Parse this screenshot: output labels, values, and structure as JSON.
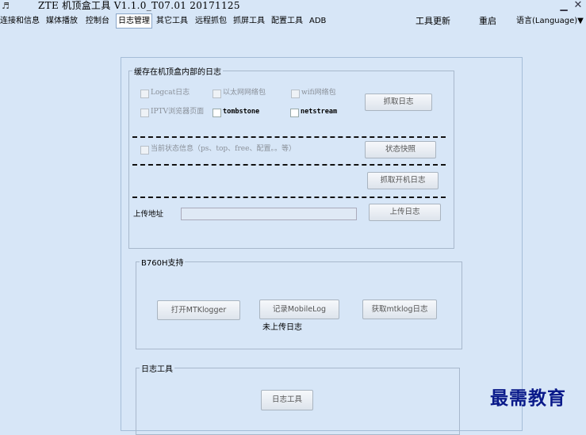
{
  "window": {
    "title": "ZTE 机顶盒工具 V1.1.0_T07.01 20171125",
    "minimize_glyph": "▁",
    "close_glyph": "✕"
  },
  "menu": {
    "items": [
      {
        "label": "连接和信息"
      },
      {
        "label": "媒体播放"
      },
      {
        "label": "控制台"
      },
      {
        "label": "日志管理"
      },
      {
        "label": "其它工具"
      },
      {
        "label": "远程抓包"
      },
      {
        "label": "抓屏工具"
      },
      {
        "label": "配置工具"
      },
      {
        "label": "ADB"
      }
    ],
    "right_items": [
      {
        "label": "工具更新"
      },
      {
        "label": "重启"
      },
      {
        "label": "语言(Language)▼"
      }
    ]
  },
  "cache_group": {
    "legend": "缓存在机顶盒内部的日志",
    "options": [
      {
        "label": "Logcat日志"
      },
      {
        "label": "以太网网络包"
      },
      {
        "label": "wifi网络包"
      },
      {
        "label": "IPTV浏览器页面"
      },
      {
        "label": "tombstone"
      },
      {
        "label": "netstream"
      }
    ],
    "capture_button": "抓取日志",
    "status_option": "当前状态信息（ps、top、free、配置。。等）",
    "snapshot_button": "状态快照",
    "boot_log_button": "抓取开机日志",
    "upload_label": "上传地址",
    "upload_value": "",
    "upload_button": "上传日志"
  },
  "b760h_group": {
    "legend": "B760H支持",
    "open_mtklogger_button": "打开MTKlogger",
    "record_mobilelog_button": "记录MobileLog",
    "get_mtklog_button": "获取mtklog日志",
    "status_text": "未上传日志"
  },
  "log_tool_group": {
    "legend": "日志工具",
    "log_tool_button": "日志工具"
  },
  "watermark": "最需教育"
}
